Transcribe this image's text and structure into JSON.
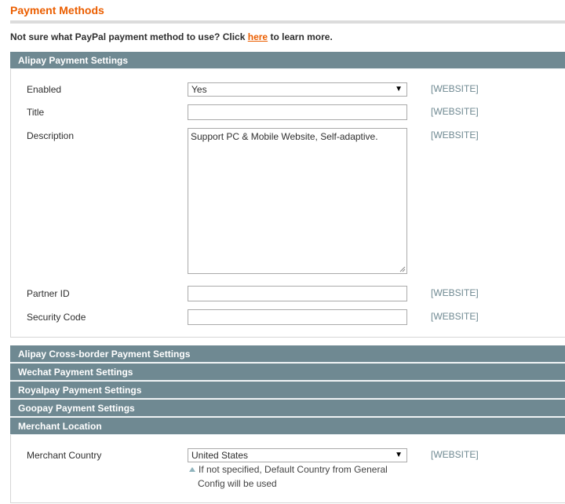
{
  "page": {
    "title": "Payment Methods",
    "notice_prefix": "Not sure what PayPal payment method to use? Click ",
    "notice_link": "here",
    "notice_suffix": " to learn more."
  },
  "alipay": {
    "header": "Alipay Payment Settings",
    "scope_label": "[WEBSITE]",
    "enabled_label": "Enabled",
    "enabled_value": "Yes",
    "title_label": "Title",
    "title_value": "",
    "description_label": "Description",
    "description_value": "Support PC & Mobile Website, Self-adaptive.",
    "partner_label": "Partner ID",
    "partner_value": "",
    "security_label": "Security Code",
    "security_value": ""
  },
  "collapsed_sections": [
    "Alipay Cross-border Payment Settings",
    "Wechat Payment Settings",
    "Royalpay Payment Settings",
    "Goopay Payment Settings"
  ],
  "merchant": {
    "header": "Merchant Location",
    "country_label": "Merchant Country",
    "country_value": "United States",
    "scope_label": "[WEBSITE]",
    "note_line1": "If not specified, Default Country from General",
    "note_line2": "Config will be used"
  },
  "icons": {
    "dropdown": "dropdown-arrow-icon",
    "resize": "resize-grip-icon",
    "note": "note-triangle-icon"
  },
  "colors": {
    "accent": "#eb5e00",
    "section_header": "#6f8992",
    "scope_text": "#6f8992"
  }
}
